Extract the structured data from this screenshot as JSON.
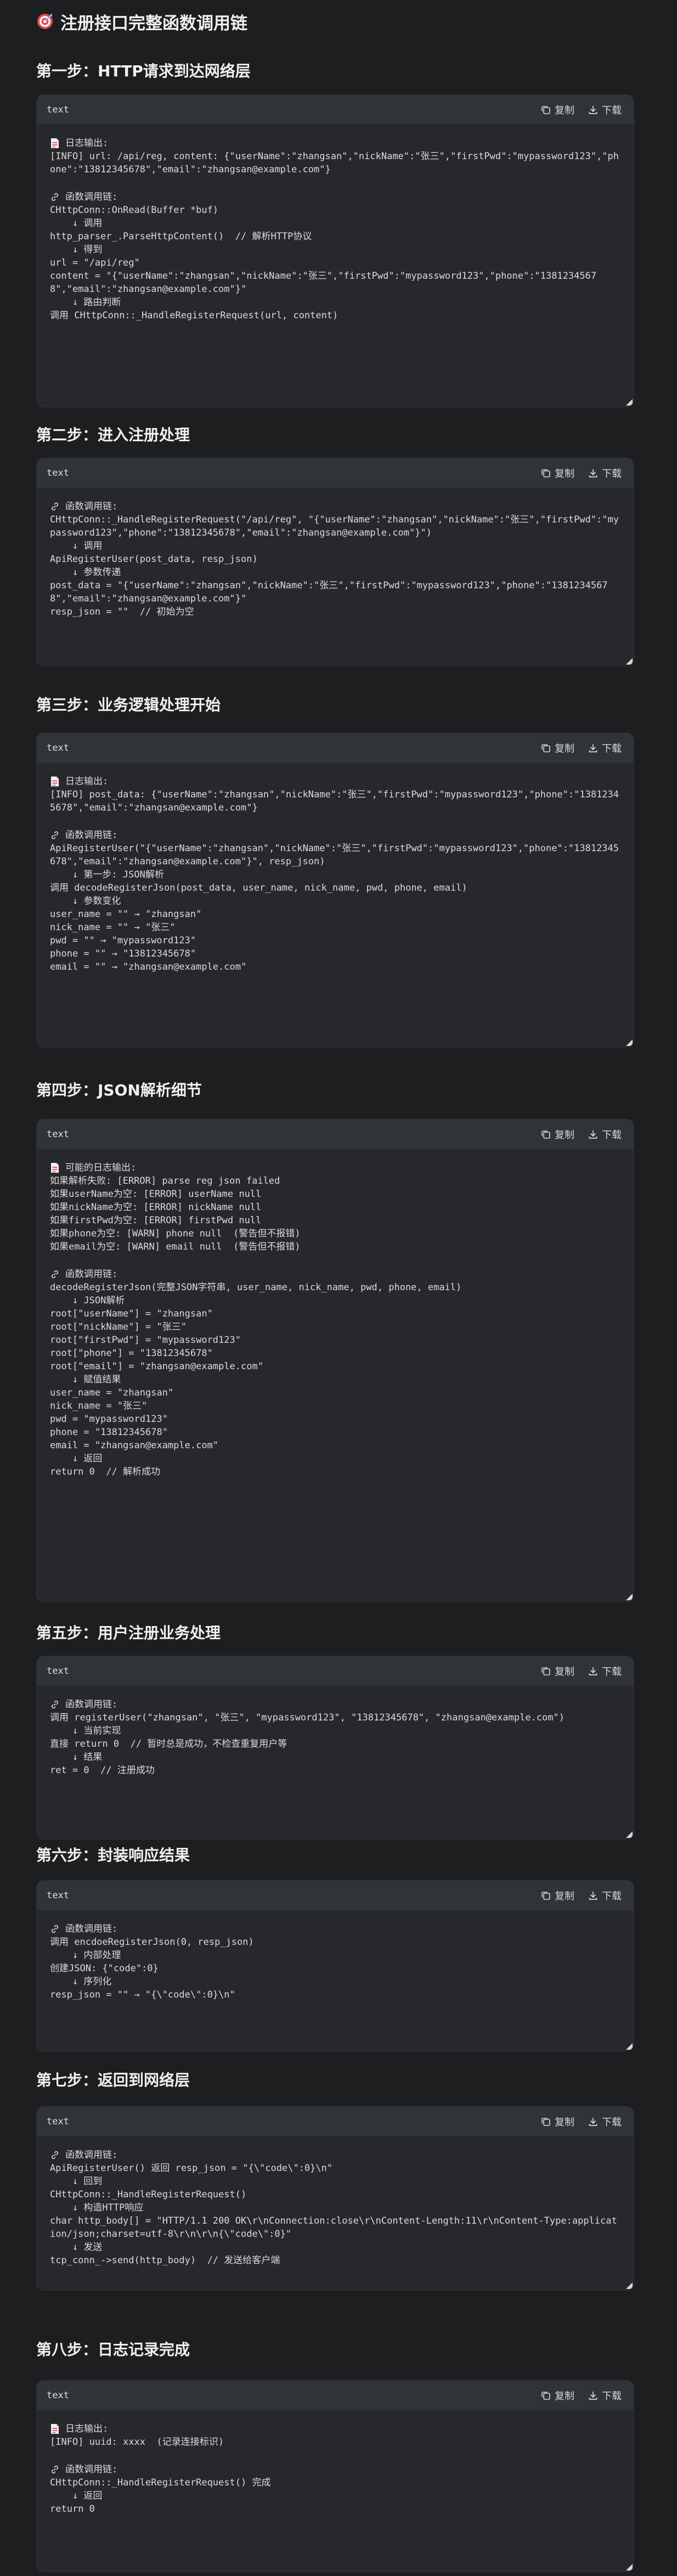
{
  "page_title": "注册接口完整函数调用链",
  "code_header": {
    "lang": "text",
    "copy_label": "复制",
    "download_label": "下载"
  },
  "steps": [
    {
      "title": "第一步：HTTP请求到达网络层",
      "lines": [
        "[I]日志输出:",
        "[INFO] url: /api/reg, content: {\"userName\":\"zhangsan\",\"nickName\":\"张三\",\"firstPwd\":\"mypassword123\",\"phone\":\"13812345678\",\"email\":\"zhangsan@example.com\"}",
        "",
        "[L]函数调用链:",
        "CHttpConn::OnRead(Buffer *buf)",
        "    ↓ 调用",
        "http_parser_.ParseHttpContent()  // 解析HTTP协议",
        "    ↓ 得到",
        "url = \"/api/reg\"",
        "content = \"{\"userName\":\"zhangsan\",\"nickName\":\"张三\",\"firstPwd\":\"mypassword123\",\"phone\":\"13812345678\",\"email\":\"zhangsan@example.com\"}\"",
        "    ↓ 路由判断",
        "调用 CHttpConn::_HandleRegisterRequest(url, content)"
      ]
    },
    {
      "title": "第二步：进入注册处理",
      "lines": [
        "[L]函数调用链:",
        "CHttpConn::_HandleRegisterRequest(\"/api/reg\", \"{\"userName\":\"zhangsan\",\"nickName\":\"张三\",\"firstPwd\":\"mypassword123\",\"phone\":\"13812345678\",\"email\":\"zhangsan@example.com\"}\")",
        "    ↓ 调用",
        "ApiRegisterUser(post_data, resp_json)",
        "    ↓ 参数传递",
        "post_data = \"{\"userName\":\"zhangsan\",\"nickName\":\"张三\",\"firstPwd\":\"mypassword123\",\"phone\":\"13812345678\",\"email\":\"zhangsan@example.com\"}\"",
        "resp_json = \"\"  // 初始为空"
      ]
    },
    {
      "title": "第三步：业务逻辑处理开始",
      "lines": [
        "[I]日志输出:",
        "[INFO] post_data: {\"userName\":\"zhangsan\",\"nickName\":\"张三\",\"firstPwd\":\"mypassword123\",\"phone\":\"13812345678\",\"email\":\"zhangsan@example.com\"}",
        "",
        "[L]函数调用链:",
        "ApiRegisterUser(\"{\"userName\":\"zhangsan\",\"nickName\":\"张三\",\"firstPwd\":\"mypassword123\",\"phone\":\"13812345678\",\"email\":\"zhangsan@example.com\"}\", resp_json)",
        "    ↓ 第一步: JSON解析",
        "调用 decodeRegisterJson(post_data, user_name, nick_name, pwd, phone, email)",
        "    ↓ 参数变化",
        "user_name = \"\" → \"zhangsan\"",
        "nick_name = \"\" → \"张三\"",
        "pwd = \"\" → \"mypassword123\"",
        "phone = \"\" → \"13812345678\"",
        "email = \"\" → \"zhangsan@example.com\""
      ]
    },
    {
      "title": "第四步：JSON解析细节",
      "lines": [
        "[I]可能的日志输出:",
        "如果解析失败: [ERROR] parse reg json failed",
        "如果userName为空: [ERROR] userName null",
        "如果nickName为空: [ERROR] nickName null",
        "如果firstPwd为空: [ERROR] firstPwd null",
        "如果phone为空: [WARN] phone null  (警告但不报错)",
        "如果email为空: [WARN] email null  (警告但不报错)",
        "",
        "[L]函数调用链:",
        "decodeRegisterJson(完整JSON字符串, user_name, nick_name, pwd, phone, email)",
        "    ↓ JSON解析",
        "root[\"userName\"] = \"zhangsan\"",
        "root[\"nickName\"] = \"张三\"",
        "root[\"firstPwd\"] = \"mypassword123\"",
        "root[\"phone\"] = \"13812345678\"",
        "root[\"email\"] = \"zhangsan@example.com\"",
        "    ↓ 赋值结果",
        "user_name = \"zhangsan\"",
        "nick_name = \"张三\"",
        "pwd = \"mypassword123\"",
        "phone = \"13812345678\"",
        "email = \"zhangsan@example.com\"",
        "    ↓ 返回",
        "return 0  // 解析成功"
      ]
    },
    {
      "title": "第五步：用户注册业务处理",
      "lines": [
        "[L]函数调用链:",
        "调用 registerUser(\"zhangsan\", \"张三\", \"mypassword123\", \"13812345678\", \"zhangsan@example.com\")",
        "    ↓ 当前实现",
        "直接 return 0  // 暂时总是成功，不检查重复用户等",
        "    ↓ 结果",
        "ret = 0  // 注册成功"
      ]
    },
    {
      "title": "第六步：封装响应结果",
      "lines": [
        "[L]函数调用链:",
        "调用 encdoeRegisterJson(0, resp_json)",
        "    ↓ 内部处理",
        "创建JSON: {\"code\":0}",
        "    ↓ 序列化",
        "resp_json = \"\" → \"{\\\"code\\\":0}\\n\""
      ]
    },
    {
      "title": "第七步：返回到网络层",
      "lines": [
        "[L]函数调用链:",
        "ApiRegisterUser() 返回 resp_json = \"{\\\"code\\\":0}\\n\"",
        "    ↓ 回到",
        "CHttpConn::_HandleRegisterRequest()",
        "    ↓ 构造HTTP响应",
        "char http_body[] = \"HTTP/1.1 200 OK\\r\\nConnection:close\\r\\nContent-Length:11\\r\\nContent-Type:application/json;charset=utf-8\\r\\n\\r\\n{\\\"code\\\":0}\"",
        "    ↓ 发送",
        "tcp_conn_->send(http_body)  // 发送给客户端"
      ]
    },
    {
      "title": "第八步：日志记录完成",
      "lines": [
        "[I]日志输出:",
        "[INFO] uuid: xxxx  (记录连接标识)",
        "",
        "[L]函数调用链:",
        "CHttpConn::_HandleRegisterRequest() 完成",
        "    ↓ 返回",
        "return 0"
      ]
    }
  ]
}
